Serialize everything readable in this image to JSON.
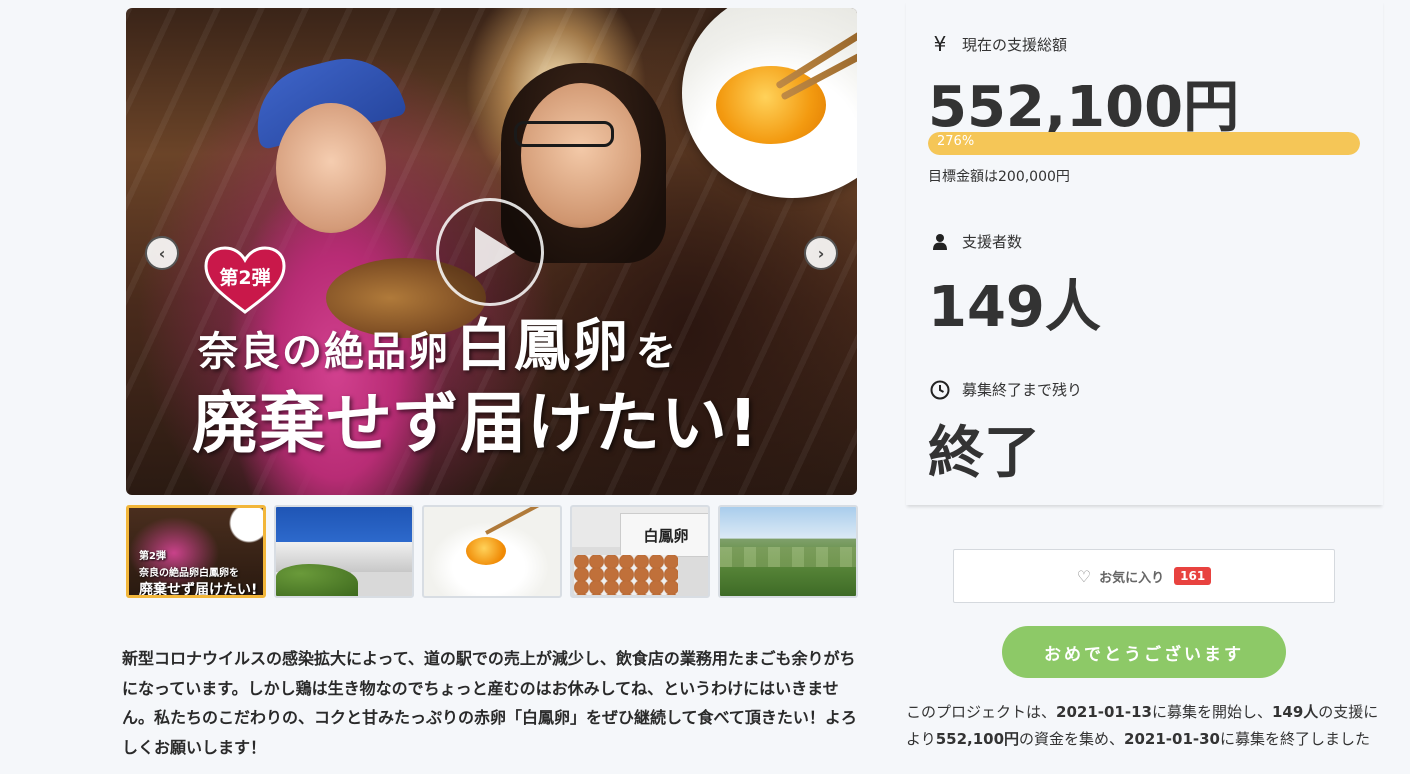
{
  "hero": {
    "badge": "第2弾",
    "title_part1": "奈良の絶品卵",
    "title_highlight": "白鳳卵",
    "title_part2": "を",
    "title_line2": "廃棄せず届けたい!",
    "prev_arrow": "‹",
    "next_arrow": "›"
  },
  "thumbnails": {
    "t1_line1": "奈良の絶品卵白鳳卵を",
    "t1_line2": "廃棄せず届けたい!",
    "t1_badge": "第2弾",
    "t4_brand": "白鳳卵"
  },
  "description": "新型コロナウイルスの感染拡大によって、道の駅での売上が減少し、飲食店の業務用たまごも余りがちになっています。しかし鶏は生き物なのでちょっと産むのはお休みしてね、というわけにはいきません。私たちのこだわりの、コクと甘みたっぷりの赤卵「白鳳卵」をぜひ継続して食べて頂きたい！よろしくお願いします！",
  "stats": {
    "total_label": "現在の支援総額",
    "total_icon": "yen-icon",
    "total_value": "552,100円",
    "progress_text": "276%",
    "progress_fraction": 1.0,
    "goal_text": "目標金額は200,000円",
    "supporters_label": "支援者数",
    "supporters_value": "149人",
    "remaining_label": "募集終了まで残り",
    "remaining_value": "終了"
  },
  "favorite": {
    "label": "お気に入り",
    "count": "161"
  },
  "congrats_button": "おめでとうございます",
  "summary": {
    "p1": "このプロジェクトは、",
    "start": "2021-01-13",
    "p2": "に募集を開始し、",
    "supporters": "149人",
    "p3": "の支援により",
    "amount": "552,100円",
    "p4": "の資金を集め、",
    "end": "2021-01-30",
    "p5": "に募集を終了しました"
  },
  "colors": {
    "progress": "#f5c657",
    "congrats": "#8dc967",
    "fav_count": "#e8423f",
    "active_thumb": "#f2b63a"
  }
}
